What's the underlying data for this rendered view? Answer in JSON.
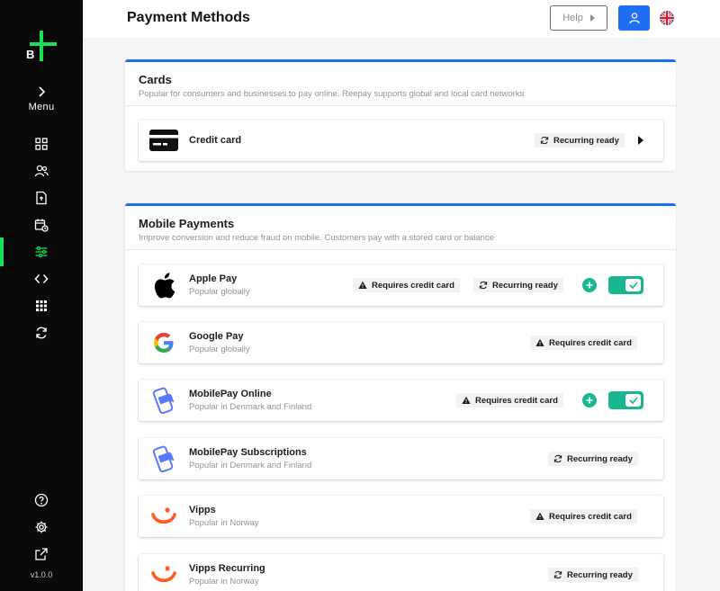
{
  "sidebar": {
    "logo_letter": "B",
    "menu_label": "Menu",
    "version": "v1.0.0",
    "nav_icons": [
      "dashboard-icon",
      "customers-icon",
      "invoices-icon",
      "subscriptions-icon",
      "configuration-icon",
      "developers-icon",
      "apps-icon",
      "sync-icon"
    ],
    "bottom_icons": [
      "help-circle-icon",
      "settings-icon",
      "external-link-icon"
    ],
    "active_color": "#19e05a"
  },
  "header": {
    "title": "Payment Methods",
    "help_label": "Help",
    "accent": "#1f6ff5"
  },
  "sections": [
    {
      "title": "Cards",
      "subtitle": "Popular for consumers and businesses to pay online. Reepay supports global and local card networks",
      "items": [
        {
          "name": "Credit card",
          "badges": [
            "Recurring ready"
          ]
        }
      ]
    },
    {
      "title": "Mobile Payments",
      "subtitle": "Improve conversion and reduce fraud on mobile. Customers pay with a stored card or balance",
      "items": [
        {
          "name": "Apple Pay",
          "sub": "Popular globally",
          "badges": [
            "Requires credit card",
            "Recurring ready"
          ],
          "enabled": true
        },
        {
          "name": "Google Pay",
          "sub": "Popular globally",
          "badges": [
            "Requires credit card"
          ]
        },
        {
          "name": "MobilePay Online",
          "sub": "Popular in Denmark and Finland",
          "badges": [
            "Requires credit card"
          ],
          "enabled": true
        },
        {
          "name": "MobilePay Subscriptions",
          "sub": "Popular in Denmark and Finland",
          "badges": [
            "Recurring ready"
          ]
        },
        {
          "name": "Vipps",
          "sub": "Popular in Norway",
          "badges": [
            "Requires credit card"
          ]
        },
        {
          "name": "Vipps Recurring",
          "sub": "Popular in Norway",
          "badges": [
            "Recurring ready"
          ]
        }
      ]
    }
  ],
  "colors": {
    "toggle_on": "#17b891",
    "vipps": "#ff5b24",
    "mobilepay": "#5a78ff"
  }
}
